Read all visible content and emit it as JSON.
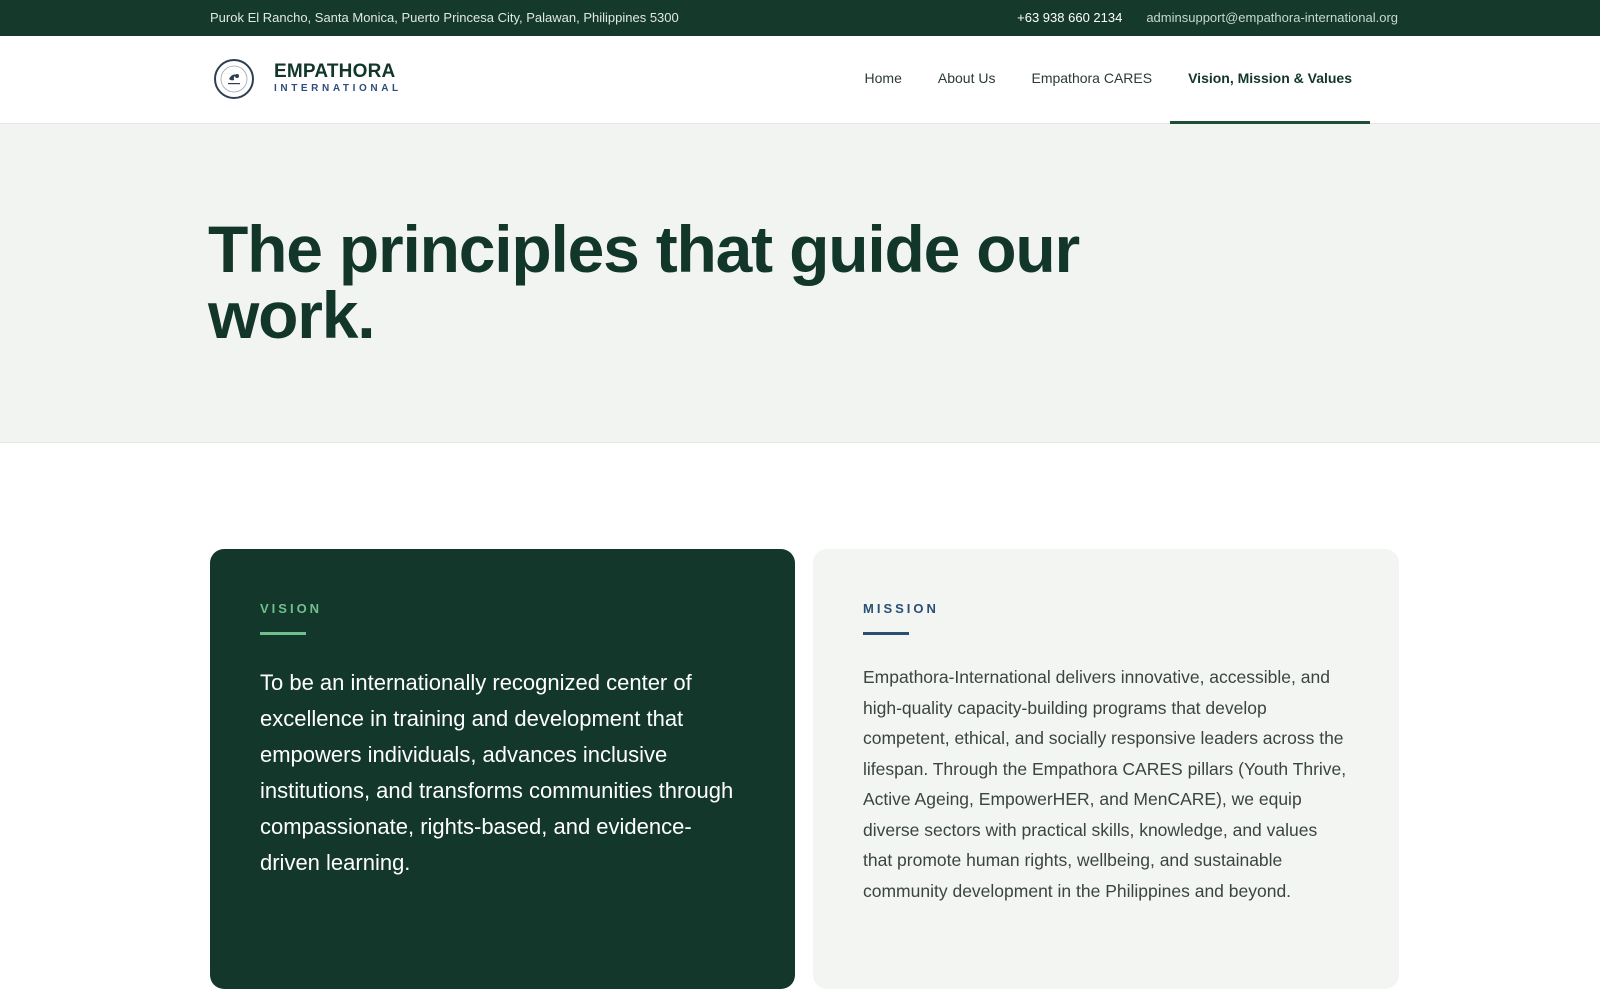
{
  "topbar": {
    "address": "Purok El Rancho, Santa Monica, Puerto Princesa City, Palawan, Philippines 5300",
    "phone": "+63 938 660 2134",
    "email": "adminsupport@empathora-international.org"
  },
  "brand": {
    "name": "EMPATHORA",
    "sub": "INTERNATIONAL",
    "logo_icon": "circular-seal-logo"
  },
  "nav": {
    "items": [
      {
        "label": "Home",
        "active": false
      },
      {
        "label": "About Us",
        "active": false
      },
      {
        "label": "Empathora CARES",
        "active": false
      },
      {
        "label": "Vision, Mission & Values",
        "active": true
      }
    ]
  },
  "hero": {
    "title": "The principles that guide our work."
  },
  "vision": {
    "label": "VISION",
    "text": "To be an internationally recognized center of excellence in training and development that empowers individuals, advances inclusive institutions, and transforms communities through compassionate, rights-based, and evidence-driven learning."
  },
  "mission": {
    "label": "MISSION",
    "text": "Empathora-International delivers innovative, accessible, and high-quality capacity-building programs that develop competent, ethical, and socially responsive leaders across the lifespan. Through the Empathora CARES pillars (Youth Thrive, Active Ageing, EmpowerHER, and MenCARE), we equip diverse sectors with practical skills, knowledge, and values that promote human rights, wellbeing, and sustainable community development in the Philippines and beyond."
  },
  "colors": {
    "dark_green": "#13382b",
    "accent_green": "#6fc08f",
    "accent_blue": "#2b4f74",
    "hero_bg": "#f2f4f2"
  }
}
